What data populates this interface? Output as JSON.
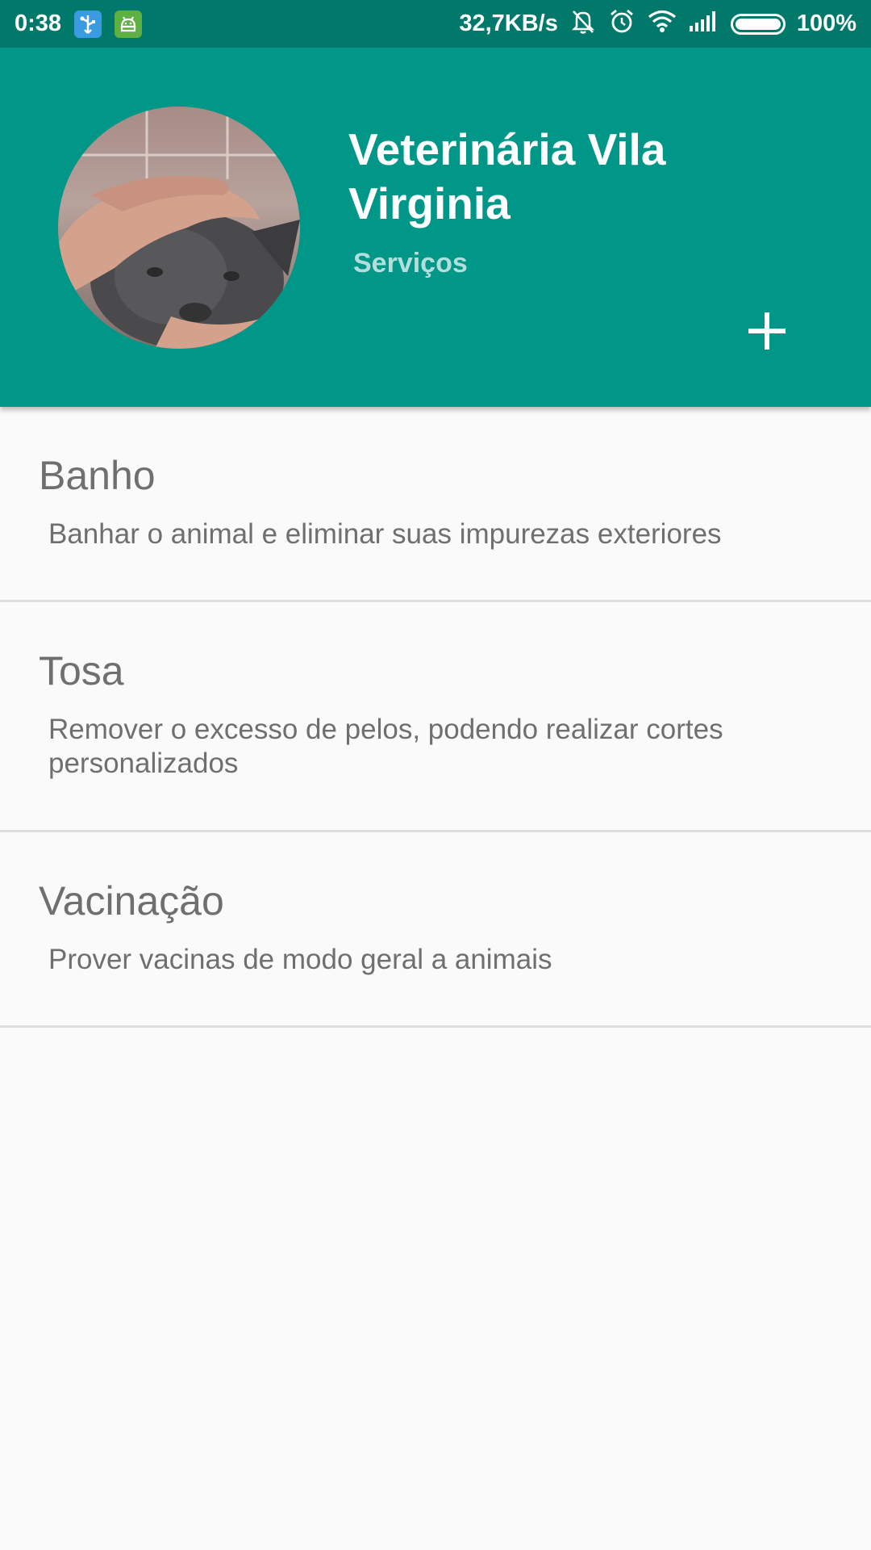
{
  "status_bar": {
    "time": "0:38",
    "speed": "32,7KB/s",
    "battery": "100%",
    "icons": [
      "usb-icon",
      "android-icon",
      "mute-icon",
      "alarm-icon",
      "wifi-icon",
      "signal-icon",
      "battery-icon"
    ]
  },
  "header": {
    "title": "Veterinária Vila Virginia",
    "subtitle": "Serviços",
    "add_icon": "plus-icon",
    "background_color": "#009688",
    "status_color": "#00796b"
  },
  "services": [
    {
      "title": "Banho",
      "description": "Banhar o animal e eliminar suas impurezas exteriores"
    },
    {
      "title": "Tosa",
      "description": "Remover o excesso de pelos, podendo realizar cortes personalizados"
    },
    {
      "title": "Vacinação",
      "description": "Prover vacinas de modo geral a animais"
    }
  ]
}
